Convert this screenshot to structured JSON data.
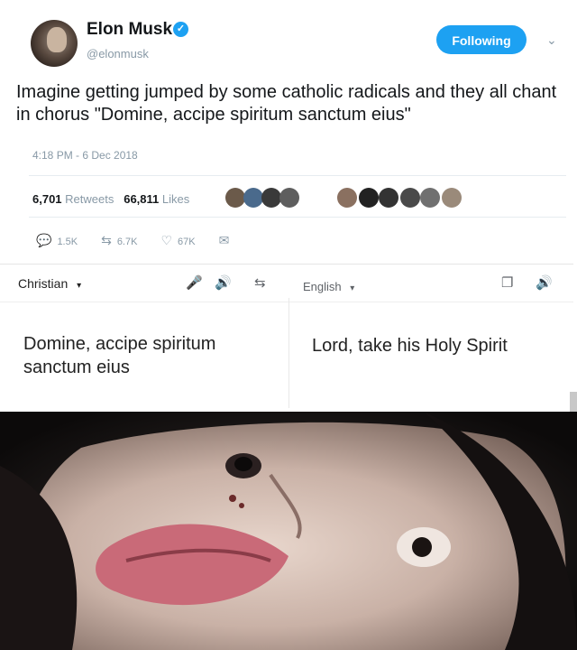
{
  "tweet": {
    "author_name": "Elon Musk",
    "handle": "@elonmusk",
    "follow_label": "Following",
    "text": "Imagine getting jumped by some catholic radicals and they all chant in chorus \"Domine, accipe spiritum sanctum eius\"",
    "timestamp": "4:18 PM - 6 Dec 2018",
    "retweets_count": "6,701",
    "retweets_label": "Retweets",
    "likes_count": "66,811",
    "likes_label": "Likes",
    "actions": {
      "replies": "1.5K",
      "retweets": "6.7K",
      "likes": "67K"
    }
  },
  "translate": {
    "source_language": "Christian",
    "target_language": "English",
    "source_text": "Domine, accipe spiritum sanctum eius",
    "translated_text": "Lord, take his Holy Spirit"
  },
  "colors": {
    "brand_blue": "#1da1f2",
    "muted": "#8899a6",
    "text": "#14171a"
  },
  "icons": [
    "verified-badge-icon",
    "chevron-down-icon",
    "reply-icon",
    "retweet-icon",
    "like-icon",
    "message-icon",
    "microphone-icon",
    "speaker-icon",
    "swap-languages-icon",
    "copy-icon"
  ]
}
